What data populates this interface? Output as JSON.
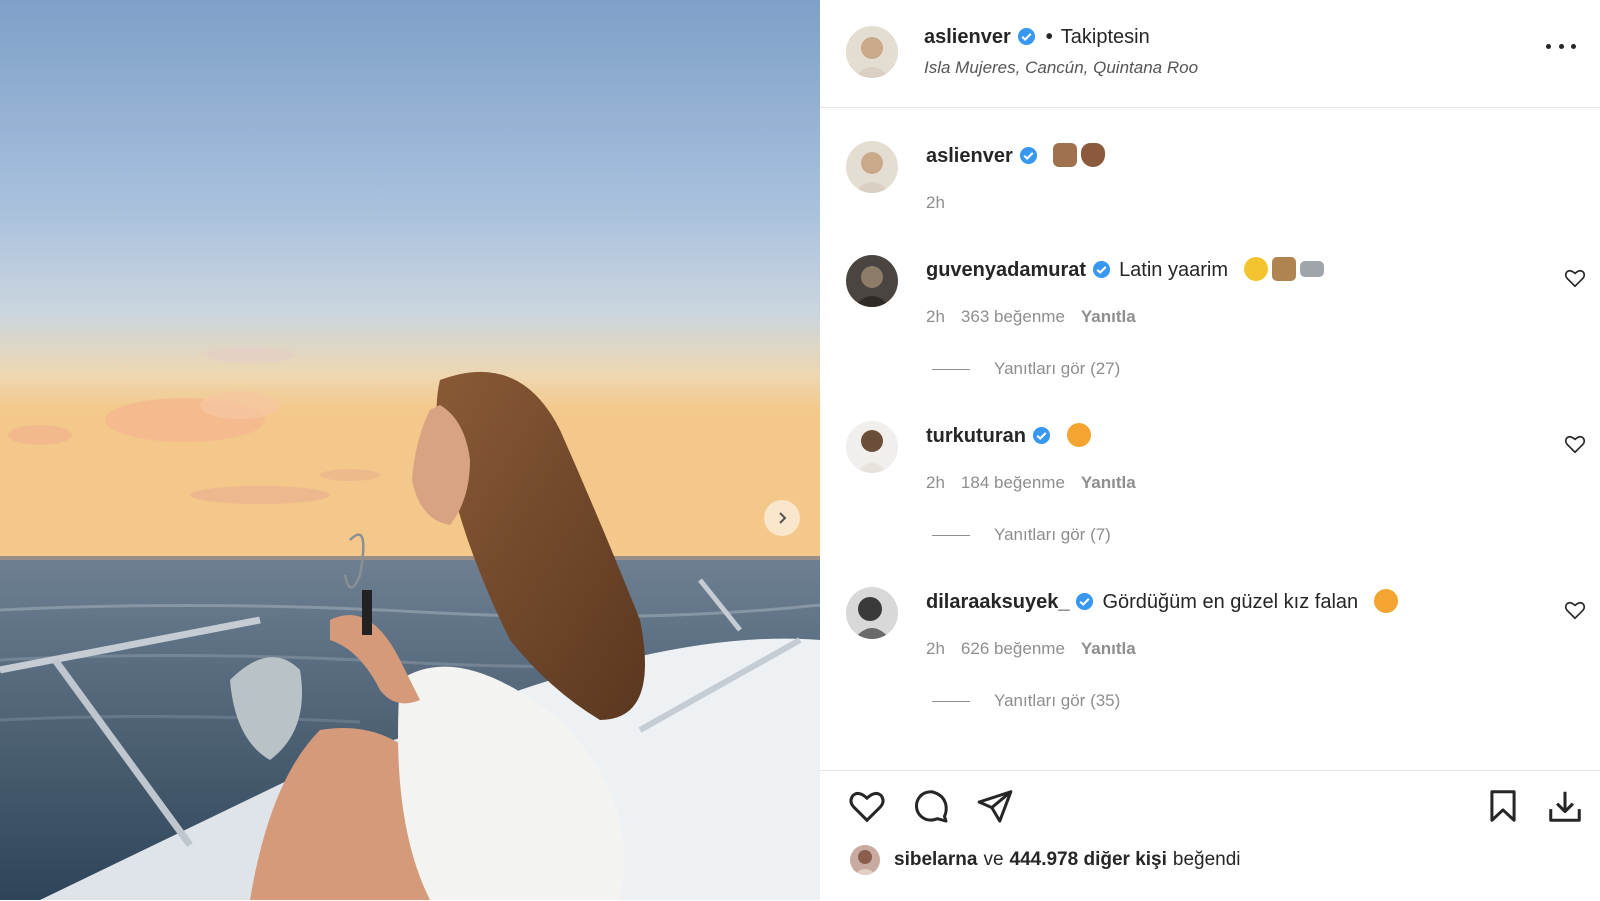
{
  "post": {
    "author": "aslienver",
    "follow_status": "Takiptesin",
    "separator": "•",
    "location": "Isla Mujeres, Cancún, Quintana Roo"
  },
  "caption": {
    "username": "aslienver",
    "time": "2h"
  },
  "comments": [
    {
      "username": "guvenyadamurat",
      "text": "Latin yaarim",
      "time": "2h",
      "likes": "363 beğenme",
      "reply": "Yanıtla",
      "view_replies": "Yanıtları gör (27)"
    },
    {
      "username": "turkuturan",
      "text": "",
      "time": "2h",
      "likes": "184 beğenme",
      "reply": "Yanıtla",
      "view_replies": "Yanıtları gör (7)"
    },
    {
      "username": "dilaraaksuyek_",
      "text": "Gördüğüm en güzel kız falan",
      "time": "2h",
      "likes": "626 beğenme",
      "reply": "Yanıtla",
      "view_replies": "Yanıtları gör (35)"
    }
  ],
  "liked_by": {
    "user": "sibelarna",
    "conj": "ve",
    "count_text": "444.978 diğer kişi",
    "suffix": "beğendi"
  },
  "icons": {
    "verified": "verified-badge-icon",
    "more": "more-options-icon",
    "like": "heart-icon",
    "comment": "comment-icon",
    "share": "send-icon",
    "save": "bookmark-icon",
    "download": "download-icon",
    "next": "chevron-right-icon"
  },
  "colors": {
    "verified_blue": "#3897f0",
    "text": "#262626",
    "secondary": "#8e8e8e"
  }
}
